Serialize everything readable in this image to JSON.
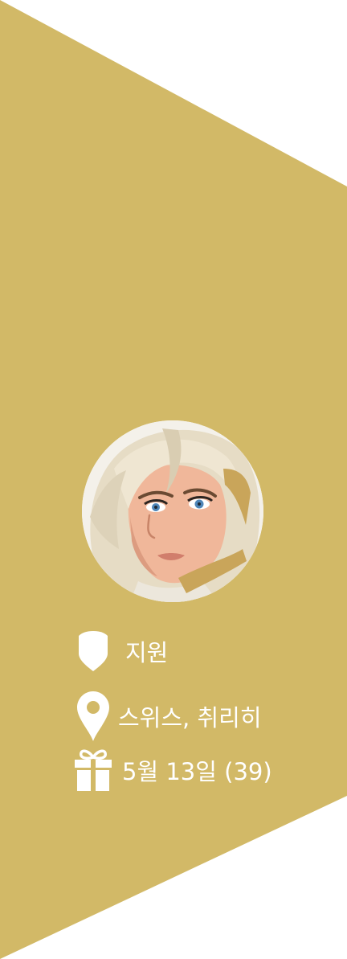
{
  "colors": {
    "panel": "#d2b967",
    "text": "#ffffff",
    "background": "#ffffff"
  },
  "profile": {
    "avatar_icon": "hero-portrait",
    "role": {
      "icon": "role-shield-icon",
      "label": "지원"
    },
    "location": {
      "icon": "map-pin-icon",
      "label": "스위스, 취리히"
    },
    "birthday": {
      "icon": "gift-icon",
      "label": "5월 13일 (39)"
    }
  }
}
